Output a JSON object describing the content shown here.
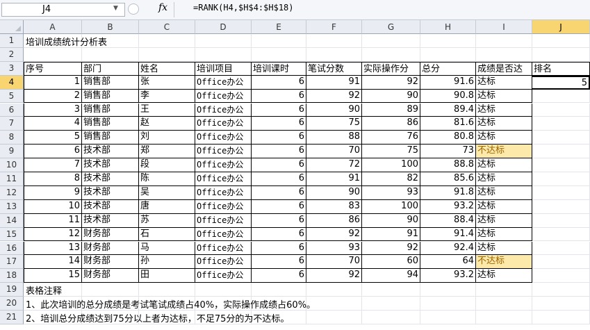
{
  "formula_bar": {
    "name_box": "J4",
    "fx_label": "fx",
    "formula": "=RANK(H4,$H$4:$H$18)"
  },
  "columns": [
    "A",
    "B",
    "C",
    "D",
    "E",
    "F",
    "G",
    "H",
    "I",
    "J"
  ],
  "selected_column": "J",
  "rows": [
    "1",
    "2",
    "3",
    "4",
    "5",
    "6",
    "7",
    "8",
    "9",
    "10",
    "11",
    "12",
    "13",
    "14",
    "15",
    "16",
    "17",
    "18",
    "19",
    "20",
    "21"
  ],
  "selected_row": "4",
  "sheet": {
    "title": "培训成绩统计分析表",
    "headers": [
      "序号",
      "部门",
      "姓名",
      "培训项目",
      "培训课时",
      "笔试分数",
      "实际操作分",
      "总分",
      "成绩是否达",
      "排名"
    ],
    "records": [
      [
        "1",
        "销售部",
        "张",
        "Office办公",
        "6",
        "91",
        "92",
        "91.6",
        "达标",
        "5"
      ],
      [
        "2",
        "销售部",
        "李",
        "Office办公",
        "6",
        "92",
        "90",
        "90.8",
        "达标",
        ""
      ],
      [
        "3",
        "销售部",
        "王",
        "Office办公",
        "6",
        "90",
        "89",
        "89.4",
        "达标",
        ""
      ],
      [
        "4",
        "销售部",
        "赵",
        "Office办公",
        "6",
        "75",
        "86",
        "81.6",
        "达标",
        ""
      ],
      [
        "5",
        "销售部",
        "刘",
        "Office办公",
        "6",
        "88",
        "76",
        "80.8",
        "达标",
        ""
      ],
      [
        "6",
        "技术部",
        "郑",
        "Office办公",
        "6",
        "70",
        "75",
        "73",
        "不达标",
        ""
      ],
      [
        "7",
        "技术部",
        "段",
        "Office办公",
        "6",
        "72",
        "100",
        "88.8",
        "达标",
        ""
      ],
      [
        "8",
        "技术部",
        "陈",
        "Office办公",
        "6",
        "91",
        "82",
        "85.6",
        "达标",
        ""
      ],
      [
        "9",
        "技术部",
        "吴",
        "Office办公",
        "6",
        "90",
        "93",
        "91.8",
        "达标",
        ""
      ],
      [
        "10",
        "技术部",
        "唐",
        "Office办公",
        "6",
        "83",
        "100",
        "93.2",
        "达标",
        ""
      ],
      [
        "11",
        "技术部",
        "苏",
        "Office办公",
        "6",
        "86",
        "90",
        "88.4",
        "达标",
        ""
      ],
      [
        "12",
        "财务部",
        "石",
        "Office办公",
        "6",
        "92",
        "91",
        "91.4",
        "达标",
        ""
      ],
      [
        "13",
        "财务部",
        "马",
        "Office办公",
        "6",
        "93",
        "92",
        "92.4",
        "达标",
        ""
      ],
      [
        "14",
        "财务部",
        "孙",
        "Office办公",
        "6",
        "70",
        "60",
        "64",
        "不达标",
        ""
      ],
      [
        "15",
        "财务部",
        "田",
        "Office办公",
        "6",
        "92",
        "94",
        "93.2",
        "达标",
        ""
      ]
    ],
    "notes_title": "表格注释",
    "notes": [
      "1、此次培训的总分成绩是考试笔试成绩占40%，实际操作成绩占60%。",
      "2、培训总分成绩达到75分以上者为达标，不足75分的为不达标。"
    ]
  },
  "colors": {
    "selected_header": "#f8d570",
    "fail_fill": "#fde9a9",
    "fail_text": "#9c6500"
  }
}
